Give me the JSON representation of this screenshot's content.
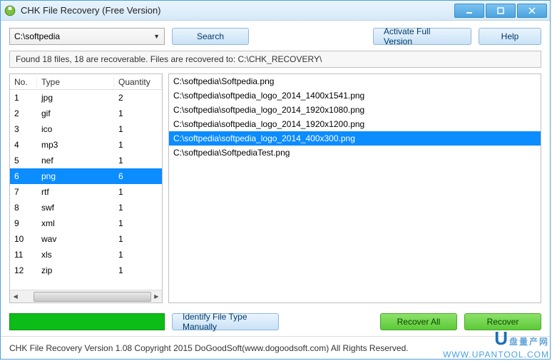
{
  "window": {
    "title": "CHK File Recovery (Free Version)"
  },
  "toolbar": {
    "path": "C:\\softpedia",
    "search_label": "Search",
    "activate_label": "Activate Full Version",
    "help_label": "Help"
  },
  "status": {
    "text": "Found 18 files, 18 are recoverable. Files are recovered to: C:\\CHK_RECOVERY\\"
  },
  "table": {
    "headers": {
      "no": "No.",
      "type": "Type",
      "qty": "Quantity"
    },
    "rows": [
      {
        "no": "1",
        "type": "jpg",
        "qty": "2"
      },
      {
        "no": "2",
        "type": "gif",
        "qty": "1"
      },
      {
        "no": "3",
        "type": "ico",
        "qty": "1"
      },
      {
        "no": "4",
        "type": "mp3",
        "qty": "1"
      },
      {
        "no": "5",
        "type": "nef",
        "qty": "1"
      },
      {
        "no": "6",
        "type": "png",
        "qty": "6"
      },
      {
        "no": "7",
        "type": "rtf",
        "qty": "1"
      },
      {
        "no": "8",
        "type": "swf",
        "qty": "1"
      },
      {
        "no": "9",
        "type": "xml",
        "qty": "1"
      },
      {
        "no": "10",
        "type": "wav",
        "qty": "1"
      },
      {
        "no": "11",
        "type": "xls",
        "qty": "1"
      },
      {
        "no": "12",
        "type": "zip",
        "qty": "1"
      }
    ],
    "selected_index": 5
  },
  "files": {
    "rows": [
      "C:\\softpedia\\Softpedia.png",
      "C:\\softpedia\\softpedia_logo_2014_1400x1541.png",
      "C:\\softpedia\\softpedia_logo_2014_1920x1080.png",
      "C:\\softpedia\\softpedia_logo_2014_1920x1200.png",
      "C:\\softpedia\\softpedia_logo_2014_400x300.png",
      "C:\\softpedia\\SoftpediaTest.png"
    ],
    "selected_index": 4
  },
  "bottom": {
    "identify_label": "Identify File Type Manually",
    "recover_all_label": "Recover All",
    "recover_label": "Recover"
  },
  "footer": {
    "text": "CHK File Recovery Version 1.08   Copyright 2015 DoGoodSoft(www.dogoodsoft.com) All Rights Reserved."
  },
  "watermark": {
    "cn_prefix": "U",
    "cn_text": "盘量产网",
    "url": "WWW.UPANTOOL.COM"
  }
}
